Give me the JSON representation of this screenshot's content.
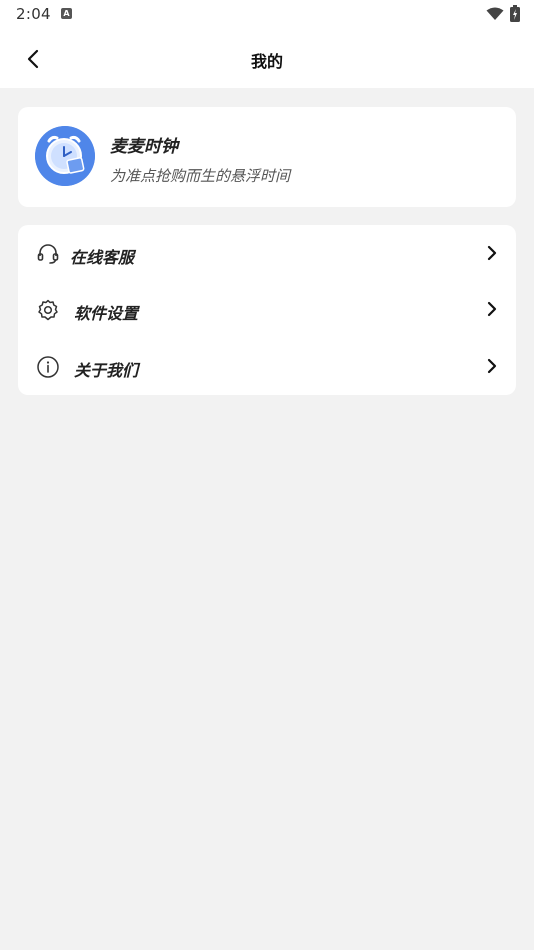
{
  "statusbar": {
    "time": "2:04",
    "notification_glyph": "A",
    "icons": [
      "wifi-icon",
      "battery-charging-icon"
    ]
  },
  "header": {
    "title": "我的",
    "back_icon": "chevron-left-icon"
  },
  "app": {
    "name": "麦麦时钟",
    "slogan": "为准点抢购而生的悬浮时间",
    "logo_icon": "alarm-clock-logo",
    "logo_color": "#4f86e9"
  },
  "menu": {
    "items": [
      {
        "label": "在线客服",
        "icon": "headset-icon"
      },
      {
        "label": "软件设置",
        "icon": "gear-icon"
      },
      {
        "label": "关于我们",
        "icon": "info-icon"
      }
    ],
    "chevron_icon": "chevron-right-icon"
  },
  "colors": {
    "background": "#f2f2f2",
    "card": "#ffffff",
    "accent": "#4f86e9"
  }
}
